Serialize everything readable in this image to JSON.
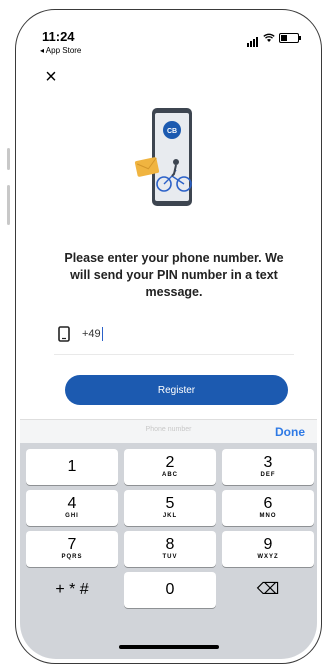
{
  "status_bar": {
    "time": "11:24",
    "back_label": "◂ App Store"
  },
  "close_label": "×",
  "illustration": {
    "icon": "phone-with-bike-illustration",
    "avatar_text": "CB"
  },
  "message": "Please enter your phone number. We will send your PIN number in a text message.",
  "phone_input": {
    "value": "+49",
    "icon": "phone-icon"
  },
  "register_button": "Register",
  "keyboard_bar": {
    "center_text": "Phone number",
    "done": "Done"
  },
  "keypad": [
    {
      "num": "1",
      "letters": ""
    },
    {
      "num": "2",
      "letters": "ABC"
    },
    {
      "num": "3",
      "letters": "DEF"
    },
    {
      "num": "4",
      "letters": "GHI"
    },
    {
      "num": "5",
      "letters": "JKL"
    },
    {
      "num": "6",
      "letters": "MNO"
    },
    {
      "num": "7",
      "letters": "PQRS"
    },
    {
      "num": "8",
      "letters": "TUV"
    },
    {
      "num": "9",
      "letters": "WXYZ"
    },
    {
      "num": "+ * #",
      "letters": ""
    },
    {
      "num": "0",
      "letters": ""
    },
    {
      "num": "⌫",
      "letters": ""
    }
  ],
  "colors": {
    "accent": "#1c5ab0",
    "done": "#2f7ae5",
    "keyboard_bg": "#d1d4d9"
  }
}
